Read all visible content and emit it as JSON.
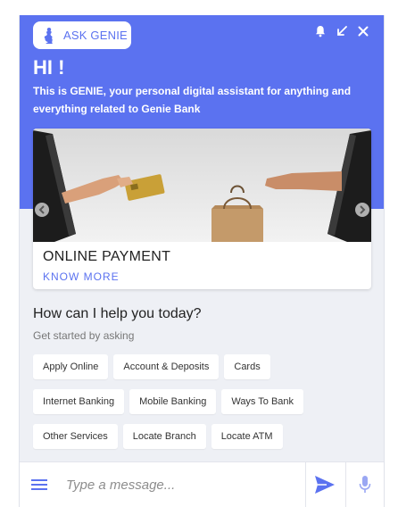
{
  "header": {
    "ask_button_label": "ASK GENIE",
    "greeting_title": "HI !",
    "greeting_subtitle": "This is GENIE, your personal digital assistant for anything and everything related to Genie Bank",
    "icons": [
      "genie-icon",
      "bell-icon",
      "minimize-icon",
      "close-icon"
    ]
  },
  "carousel": {
    "card_title": "ONLINE PAYMENT",
    "card_link": "KNOW MORE",
    "image_subject": "hands-card-payment-shopping-bag"
  },
  "help": {
    "title": "How can I help you today?",
    "subtitle": "Get started by asking"
  },
  "suggestions": [
    [
      "Apply Online",
      "Account & Deposits",
      "Cards"
    ],
    [
      "Internet Banking",
      "Mobile Banking",
      "Ways To Bank"
    ],
    [
      "Other Services",
      "Locate Branch",
      "Locate ATM"
    ]
  ],
  "composer": {
    "placeholder": "Type a message...",
    "icons": [
      "menu-icon",
      "send-icon",
      "microphone-icon"
    ]
  },
  "colors": {
    "brand": "#5b72f0",
    "background": "#eef0f5",
    "mic_icon": "#9aa7f3"
  }
}
